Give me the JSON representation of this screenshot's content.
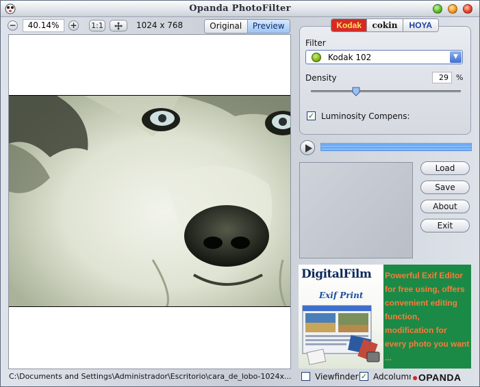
{
  "window": {
    "title": "Opanda PhotoFilter"
  },
  "toolbar": {
    "zoom": "40.14%",
    "zoom_out_symbol": "−",
    "zoom_in_symbol": "+",
    "actual_size_label": "1:1",
    "fit_icon": "move-arrows-icon",
    "resolution": "1024 x 768",
    "view_modes": [
      "Original",
      "Preview"
    ],
    "selected_view": "Preview"
  },
  "brands": [
    "Kodak",
    "cokin",
    "HOYA"
  ],
  "selected_brand": "Kodak",
  "filter": {
    "label": "Filter",
    "value": "Kodak 102",
    "density_label": "Density",
    "density_value": "29",
    "density_unit": "%",
    "density_level": 0.29,
    "luminosity_label": "Luminosity Compens:",
    "luminosity_checked": true
  },
  "actions": {
    "load": "Load",
    "save": "Save",
    "about": "About",
    "exit": "Exit"
  },
  "ad": {
    "title": "DigitalFilm",
    "subtitle": "Exif Print",
    "text": "Powerful Exif Editor for free using, offers convenient editing function, modification for every photo you want ..."
  },
  "status": {
    "path": "C:\\Documents and Settings\\Administrador\\Escritorio\\cara_de_lobo-1024x...",
    "viewfinder_label": "Viewfinder",
    "viewfinder_checked": false,
    "adcolumn_label": "Adcolumr",
    "adcolumn_checked": true,
    "logo": "OPANDA"
  },
  "colors": {
    "accent": "#3f6fcd",
    "kodak_red": "#d62a26",
    "ad_green": "#1b8a46",
    "ad_text": "#ff7a3a"
  }
}
